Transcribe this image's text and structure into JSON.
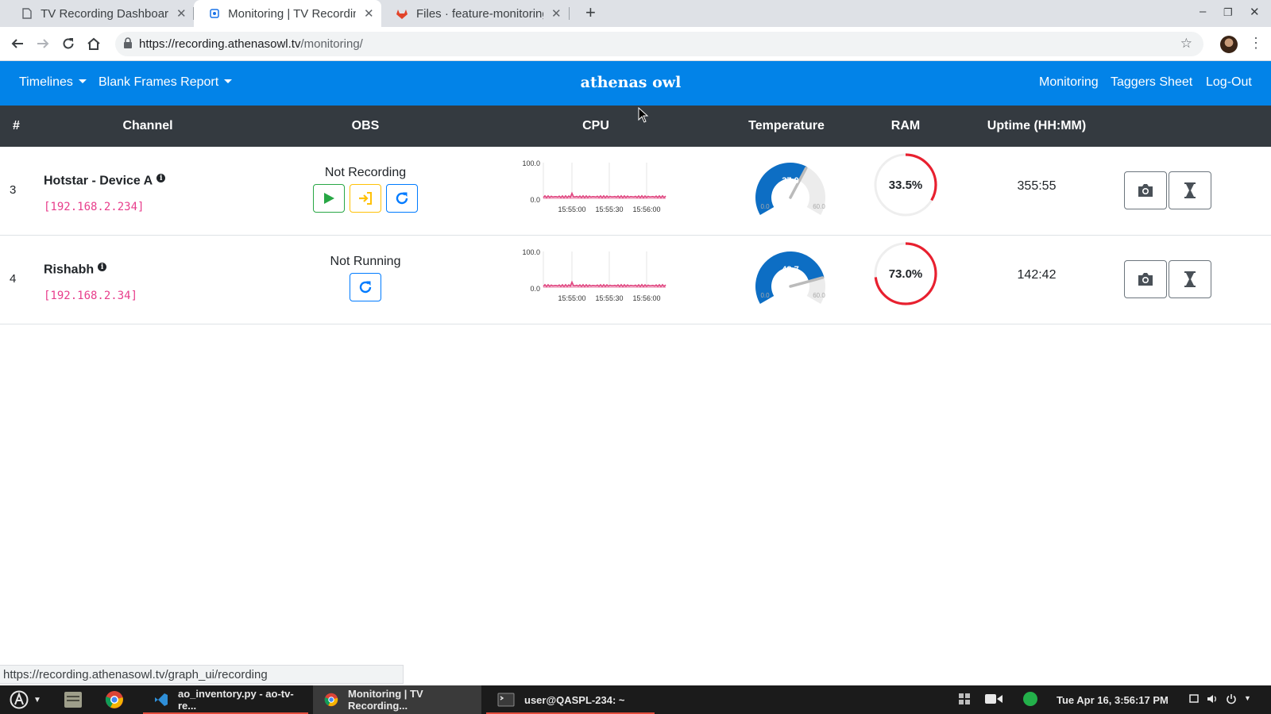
{
  "browser": {
    "tabs": [
      {
        "title": "TV Recording Dashboard",
        "active": false
      },
      {
        "title": "Monitoring | TV Recording",
        "active": true
      },
      {
        "title": "Files · feature-monitoring",
        "active": false
      }
    ],
    "url": {
      "host": "https://recording.athenasowl.tv",
      "path": "/monitoring/"
    },
    "status_url": "https://recording.athenasowl.tv/graph_ui/recording"
  },
  "navbar": {
    "left": [
      "Timelines",
      "Blank Frames Report"
    ],
    "brand": "athenas owl",
    "right": [
      "Monitoring",
      "Taggers Sheet",
      "Log-Out"
    ]
  },
  "table": {
    "headers": {
      "num": "#",
      "channel": "Channel",
      "obs": "OBS",
      "cpu": "CPU",
      "temperature": "Temperature",
      "ram": "RAM",
      "uptime": "Uptime (HH:MM)"
    },
    "rows": [
      {
        "num": "3",
        "name": "Hotstar - Device A",
        "ip": "[192.168.2.234]",
        "obs_status": "Not Recording",
        "temperature": 37.0,
        "temp_label": "37.0",
        "ram_percent": 33.5,
        "ram_label": "33.5%",
        "uptime": "355:55"
      },
      {
        "num": "4",
        "name": "Rishabh",
        "ip": "[192.168.2.34]",
        "obs_status": "Not Running",
        "temperature": 48.7,
        "temp_label": "48.7",
        "ram_percent": 73.0,
        "ram_label": "73.0%",
        "uptime": "142:42"
      }
    ],
    "cpu_chart": {
      "y_top": "100.0",
      "y_bottom": "0.0",
      "x_ticks": [
        "15:55:00",
        "15:55:30",
        "15:56:00"
      ]
    },
    "gauge": {
      "min": "0.0",
      "max": "60.0"
    }
  },
  "taskbar": {
    "tasks": [
      "ao_inventory.py - ao-tv-re...",
      "Monitoring | TV Recording...",
      "user@QASPL-234: ~"
    ],
    "clock": "Tue Apr 16, 3:56:17 PM"
  },
  "colors": {
    "primary": "#0283e8",
    "header_dark": "#343a40",
    "ip_pink": "#e83e8c",
    "gauge_blue": "#0d6ec4",
    "ram_red": "#e8202f"
  }
}
